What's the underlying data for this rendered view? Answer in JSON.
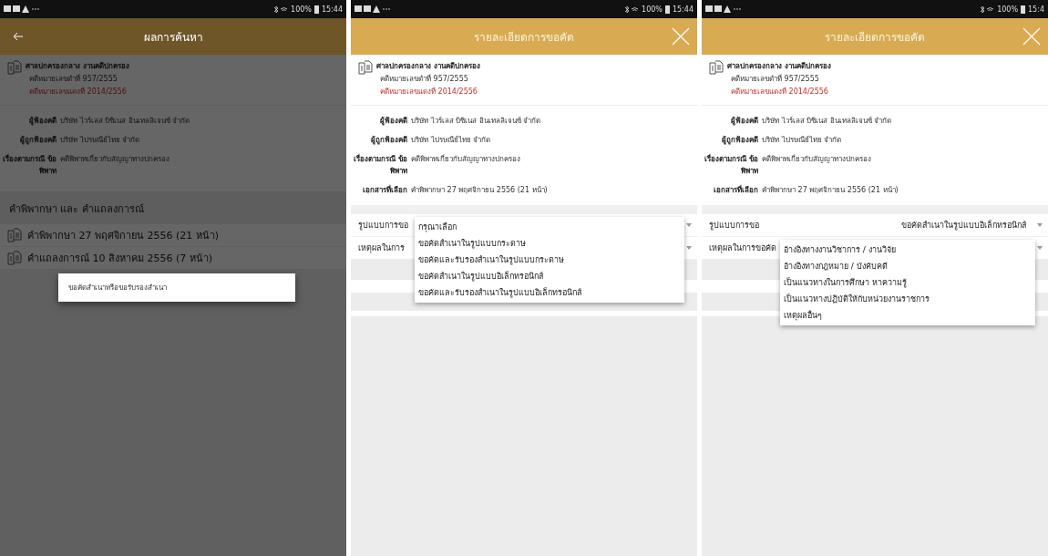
{
  "screens": [
    {
      "kind": "results",
      "status_bar": {
        "battery": "100%",
        "time": "15:44"
      },
      "header": {
        "title": "ผลการค้นหา"
      },
      "case": {
        "court": "ศาลปกครองกลาง งานคดีปกครอง",
        "black_number": "คดีหมายเลขดำที่ 957/2555",
        "red_number": "คดีหมายเลขแดงที่ 2014/2556"
      },
      "details": [
        {
          "label": "ผู้ฟ้องคดี",
          "value": "บริษัท ไวร์เลส บิซิเนส อินเทลลิเจนซ์ จำกัด"
        },
        {
          "label": "ผู้ถูกฟ้องคดี",
          "value": "บริษัท ไปรษณีย์ไทย จำกัด"
        },
        {
          "label": "เรื่องตามกรณี ข้อพิพาท",
          "value": "คดีพิพาทเกี่ยวกับสัญญาทางปกครอง"
        }
      ],
      "section_title": "คำพิพากษา และ คำแถลงการณ์",
      "documents": [
        "คำพิพากษา 27 พฤศจิกายน 2556 (21 หน้า)",
        "คำแถลงการณ์ 10 สิงหาคม 2556 (7 หน้า)"
      ],
      "dialog": {
        "option": "ขอคัดสำเนาหรือขอรับรองสำเนา"
      }
    },
    {
      "kind": "request",
      "status_bar": {
        "battery": "100%",
        "time": "15:44"
      },
      "header": {
        "title": "รายละเอียดการขอคัด"
      },
      "case": {
        "court": "ศาลปกครองกลาง งานคดีปกครอง",
        "black_number": "คดีหมายเลขดำที่ 957/2555",
        "red_number": "คดีหมายเลขแดงที่ 2014/2556"
      },
      "details": [
        {
          "label": "ผู้ฟ้องคดี",
          "value": "บริษัท ไวร์เลส บิซิเนส อินเทลลิเจนซ์ จำกัด"
        },
        {
          "label": "ผู้ถูกฟ้องคดี",
          "value": "บริษัท ไปรษณีย์ไทย จำกัด"
        },
        {
          "label": "เรื่องตามกรณี ข้อพิพาท",
          "value": "คดีพิพาทเกี่ยวกับสัญญาทางปกครอง"
        },
        {
          "label": "เอกสารที่เลือก",
          "value": "คำพิพากษา 27 พฤศจิกายน 2556 (21 หน้า)"
        }
      ],
      "form": [
        {
          "label": "รูปแบบการขอ",
          "expanded": true,
          "options": [
            "กรุณาเลือก",
            "ขอคัดสำเนาในรูปแบบกระดาษ",
            "ขอคัดและรับรองสำเนาในรูปแบบกระดาษ",
            "ขอคัดสำเนาในรูปแบบอิเล็กทรอนิกส์",
            "ขอคัดและรับรองสำเนาในรูปแบบอิเล็กทรอนิกส์"
          ]
        },
        {
          "label": "เหตุผลในการ",
          "expanded": false
        }
      ]
    },
    {
      "kind": "request",
      "status_bar": {
        "battery": "100%",
        "time": "15:4"
      },
      "header": {
        "title": "รายละเอียดการขอคัด"
      },
      "case": {
        "court": "ศาลปกครองกลาง งานคดีปกครอง",
        "black_number": "คดีหมายเลขดำที่ 957/2555",
        "red_number": "คดีหมายเลขแดงที่ 2014/2556"
      },
      "details": [
        {
          "label": "ผู้ฟ้องคดี",
          "value": "บริษัท ไวร์เลส บิซิเนส อินเทลลิเจนซ์ จำกัด"
        },
        {
          "label": "ผู้ถูกฟ้องคดี",
          "value": "บริษัท ไปรษณีย์ไทย จำกัด"
        },
        {
          "label": "เรื่องตามกรณี ข้อพิพาท",
          "value": "คดีพิพาทเกี่ยวกับสัญญาทางปกครอง"
        },
        {
          "label": "เอกสารที่เลือก",
          "value": "คำพิพากษา 27 พฤศจิกายน 2556 (21 หน้า)"
        }
      ],
      "form": [
        {
          "label": "รูปแบบการขอ",
          "value": "ขอคัดสำเนาในรูปแบบอิเล็กทรอนิกส์",
          "expanded": false
        },
        {
          "label": "เหตุผลในการขอคัด",
          "expanded": true,
          "options": [
            "อ้างอิงทางงานวิชาการ / งานวิจัย",
            "อ้างอิงทางกฎหมาย / บังคับคดี",
            "เป็นแนวทางในการศึกษา หาความรู้",
            "เป็นแนวทางปฏิบัติให้กับหน่วยงานราชการ",
            "เหตุผลอื่นๆ"
          ]
        }
      ]
    }
  ]
}
